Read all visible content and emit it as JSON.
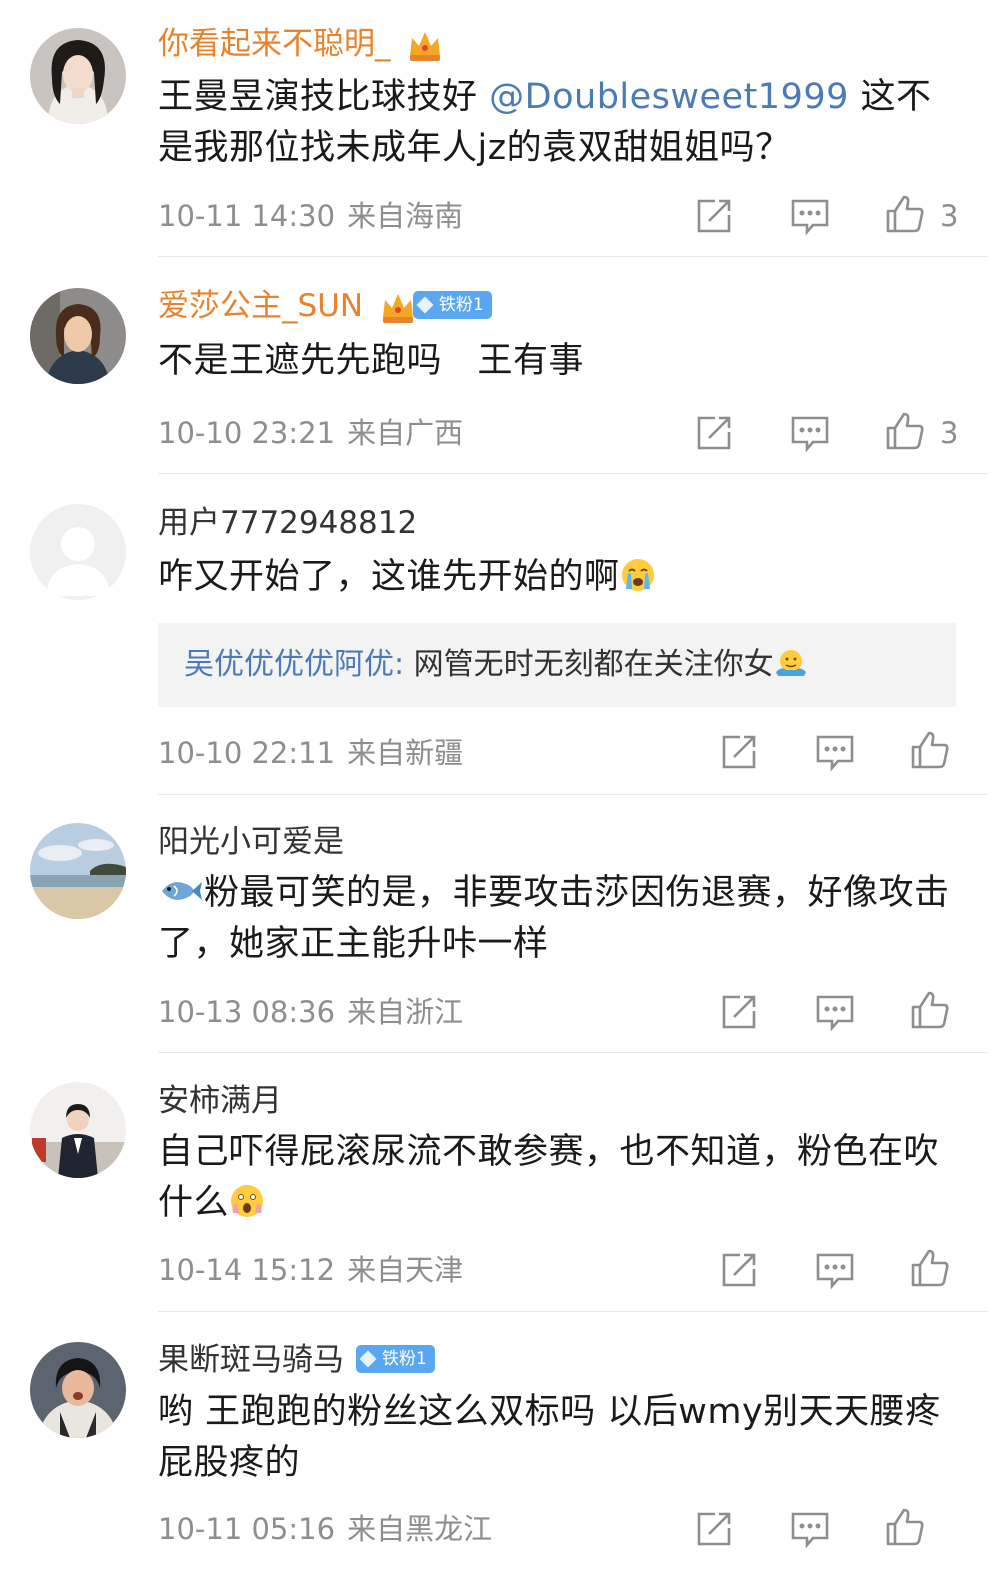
{
  "comments": [
    {
      "username": "你看起来不聪明_",
      "text_before": "王曼昱演技比球技好 ",
      "mention": "@Doublesweet1999",
      "text_after": " 这不是我那位找未成年人jz的袁双甜姐姐吗？",
      "time": "10-11 14:30",
      "location": "来自海南",
      "likes": "3"
    },
    {
      "username": "爱莎公主_SUN",
      "badge": "铁粉1",
      "text": "不是王遮先先跑吗　王有事",
      "time": "10-10 23:21",
      "location": "来自广西",
      "likes": "3"
    },
    {
      "username": "用户7772948812",
      "text": "咋又开始了，这谁先开始的啊",
      "reply_user": "吴优优优优阿优:",
      "reply_text": " 网管无时无刻都在关注你女",
      "time": "10-10 22:11",
      "location": "来自新疆"
    },
    {
      "username": "阳光小可爱是",
      "text": "粉最可笑的是，非要攻击莎因伤退赛，好像攻击了，她家正主能升咔一样",
      "time": "10-13 08:36",
      "location": "来自浙江"
    },
    {
      "username": "安柿满月",
      "text": "自己吓得屁滚尿流不敢参赛，也不知道，粉色在吹什么",
      "time": "10-14 15:12",
      "location": "来自天津"
    },
    {
      "username": "果断斑马骑马",
      "badge": "铁粉1",
      "text": "哟 王跑跑的粉丝这么双标吗 以后wmy别天天腰疼 屁股疼的",
      "time": "10-11 05:16",
      "location": "来自黑龙江"
    }
  ],
  "icons": {
    "share": "share-icon",
    "comment": "comment-icon",
    "like": "thumbs-up-icon",
    "crown": "crown-icon",
    "diamond": "diamond-icon"
  },
  "colors": {
    "vip_name": "#e8822b",
    "mention": "#4a7bb7",
    "meta": "#8e8e8e",
    "badge": "#5aa7f1"
  }
}
